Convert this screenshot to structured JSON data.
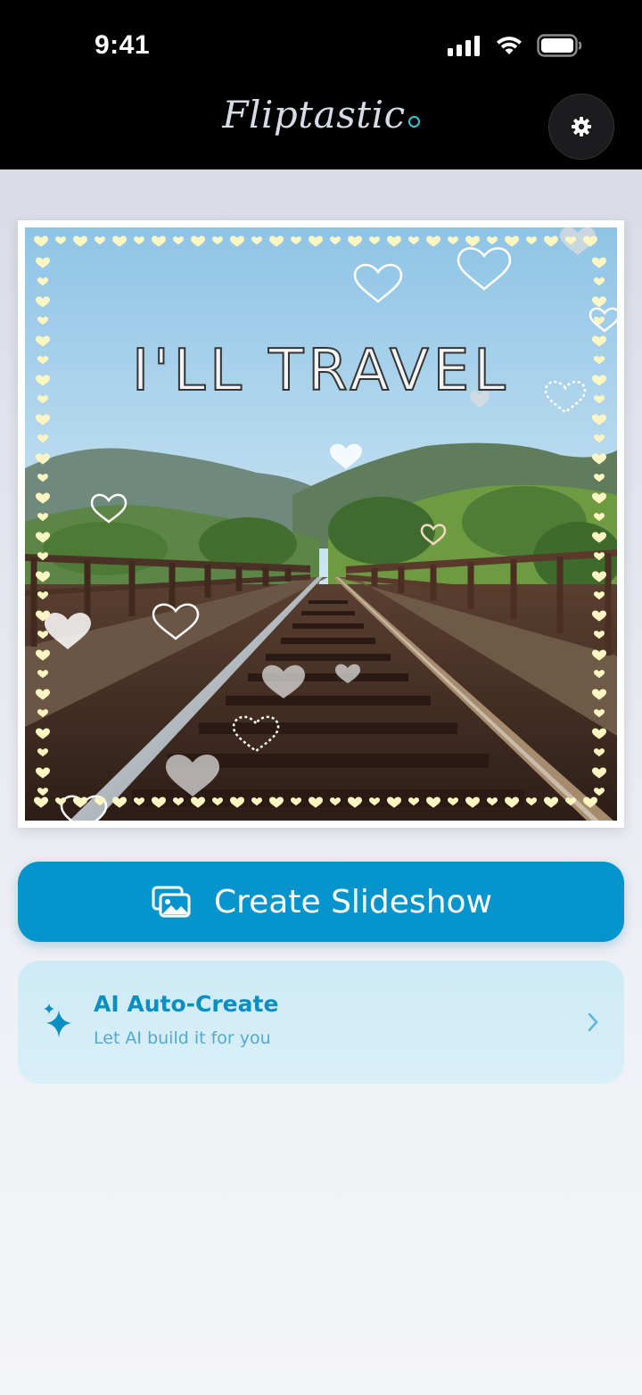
{
  "status_bar": {
    "time": "9:41"
  },
  "header": {
    "app_name": "Fliptastic"
  },
  "photo": {
    "overlay_text": "I'LL TRAVEL"
  },
  "actions": {
    "create_label": "Create Slideshow",
    "ai_title": "AI Auto-Create",
    "ai_subtitle": "Let AI build it for you"
  },
  "icons": {
    "settings": "gear-icon",
    "create": "photos-stack-icon",
    "ai": "sparkles-icon",
    "ai_arrow": "chevron-right-icon"
  },
  "colors": {
    "primary": "#0595cc",
    "ai_card_bg": "#d2ecf7",
    "ai_text": "#0a8fc0",
    "header_bg": "#000000",
    "logo_accent": "#38c6d6"
  }
}
